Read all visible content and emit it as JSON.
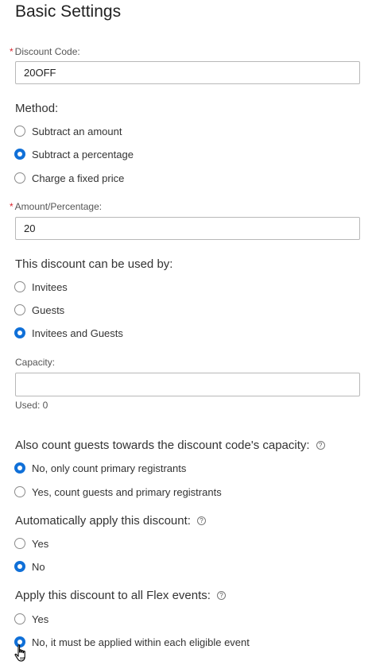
{
  "page": {
    "title": "Basic Settings"
  },
  "discount_code": {
    "label": "Discount Code:",
    "required_mark": "*",
    "value": "20OFF"
  },
  "method": {
    "label": "Method:",
    "options": [
      {
        "label": "Subtract an amount",
        "checked": false
      },
      {
        "label": "Subtract a percentage",
        "checked": true
      },
      {
        "label": "Charge a fixed price",
        "checked": false
      }
    ]
  },
  "amount": {
    "label": "Amount/Percentage:",
    "required_mark": "*",
    "value": "20"
  },
  "used_by": {
    "label": "This discount can be used by:",
    "options": [
      {
        "label": "Invitees",
        "checked": false
      },
      {
        "label": "Guests",
        "checked": false
      },
      {
        "label": "Invitees and Guests",
        "checked": true
      }
    ]
  },
  "capacity": {
    "label": "Capacity:",
    "value": "",
    "used_text": "Used: 0"
  },
  "count_guests": {
    "label": "Also count guests towards the discount code's capacity:",
    "help_icon": "question-circle-icon",
    "options": [
      {
        "label": "No, only count primary registrants",
        "checked": true
      },
      {
        "label": "Yes, count guests and primary registrants",
        "checked": false
      }
    ]
  },
  "auto_apply": {
    "label": "Automatically apply this discount:",
    "help_icon": "question-circle-icon",
    "options": [
      {
        "label": "Yes",
        "checked": false
      },
      {
        "label": "No",
        "checked": true
      }
    ]
  },
  "flex_events": {
    "label": "Apply this discount to all Flex events:",
    "help_icon": "question-circle-icon",
    "options": [
      {
        "label": "Yes",
        "checked": false
      },
      {
        "label": "No, it must be applied within each eligible event",
        "checked": true
      }
    ]
  },
  "colors": {
    "accent": "#1070d8",
    "required": "#d9232d",
    "border": "#b8b8b8"
  },
  "cursor": "hand-pointer-icon"
}
